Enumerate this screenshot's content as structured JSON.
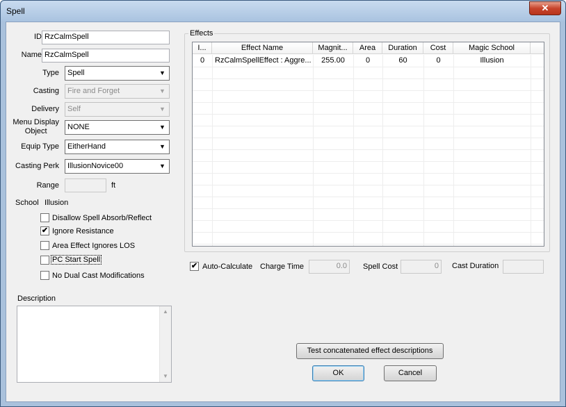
{
  "window": {
    "title": "Spell",
    "close_glyph": "✕"
  },
  "form": {
    "id_label": "ID",
    "id_value": "RzCalmSpell",
    "name_label": "Name",
    "name_value": "RzCalmSpell",
    "type_label": "Type",
    "type_value": "Spell",
    "casting_label": "Casting",
    "casting_value": "Fire and Forget",
    "delivery_label": "Delivery",
    "delivery_value": "Self",
    "menu_display_label_1": "Menu Display",
    "menu_display_label_2": "Object",
    "menu_display_value": "NONE",
    "equip_type_label": "Equip Type",
    "equip_type_value": "EitherHand",
    "casting_perk_label": "Casting Perk",
    "casting_perk_value": "IllusionNovice00",
    "range_label": "Range",
    "range_value": "",
    "range_unit": "ft",
    "school_label": "School",
    "school_value": "Illusion"
  },
  "checkboxes": [
    {
      "label": "Disallow Spell Absorb/Reflect",
      "checked": false
    },
    {
      "label": "Ignore Resistance",
      "checked": true
    },
    {
      "label": "Area Effect Ignores LOS",
      "checked": false
    },
    {
      "label": "PC Start Spell",
      "checked": false
    },
    {
      "label": "No Dual Cast Modifications",
      "checked": false
    }
  ],
  "check_mark": "✔",
  "description": {
    "label": "Description",
    "value": ""
  },
  "effects": {
    "title": "Effects",
    "columns": [
      "I...",
      "Effect Name",
      "Magnit...",
      "Area",
      "Duration",
      "Cost",
      "Magic School"
    ],
    "rows": [
      [
        "0",
        "RzCalmSpellEffect : Aggre...",
        "255.00",
        "0",
        "60",
        "0",
        "Illusion"
      ]
    ]
  },
  "calc": {
    "auto_label": "Auto-Calculate",
    "auto_checked": true,
    "charge_time_label": "Charge Time",
    "charge_time_value": "0.0",
    "spell_cost_label": "Spell Cost",
    "spell_cost_value": "0",
    "cast_duration_label": "Cast Duration",
    "cast_duration_value": ""
  },
  "buttons": {
    "test_label": "Test concatenated effect descriptions",
    "ok_label": "OK",
    "cancel_label": "Cancel"
  },
  "icons": {
    "dropdown": "chevron-down-icon",
    "scroll_up": "arrow-up-icon",
    "scroll_down": "arrow-down-icon"
  }
}
